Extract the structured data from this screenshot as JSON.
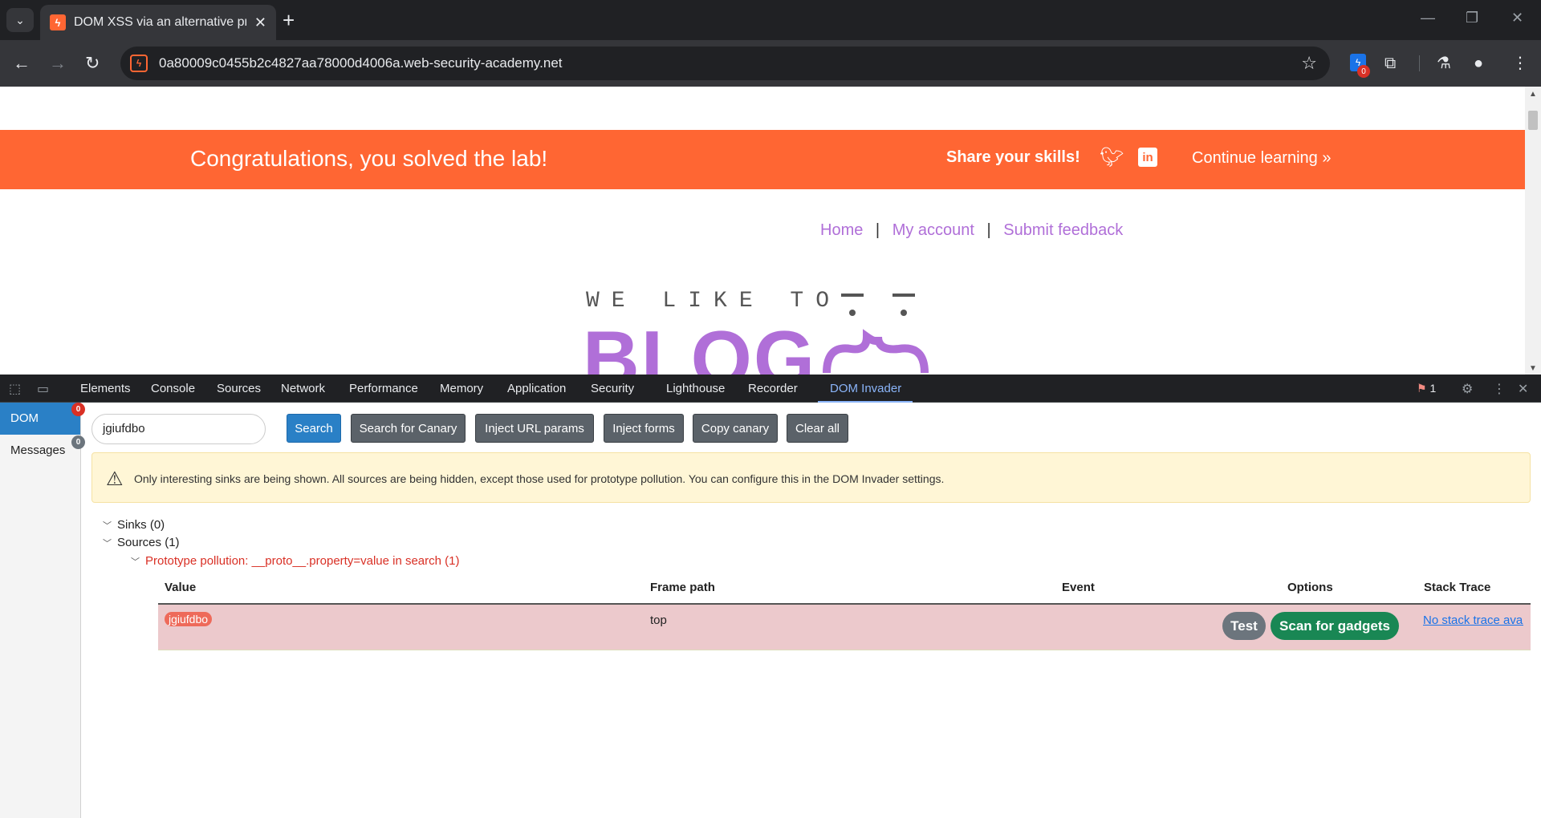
{
  "browser": {
    "tab_title": "DOM XSS via an alternative prototype pollution vector",
    "url": "0a80009c0455b2c4827aa78000d4006a.web-security-academy.net",
    "extension_count": "0"
  },
  "page": {
    "banner": {
      "message": "Congratulations, you solved the lab!",
      "share": "Share your skills!",
      "continue": "Continue learning"
    },
    "nav": {
      "home": "Home",
      "separator": "|",
      "my_account": "My account",
      "submit_feedback": "Submit feedback"
    },
    "logo": {
      "top": "WE LIKE TO",
      "main": "BLOG"
    }
  },
  "devtools": {
    "tabs": [
      "Elements",
      "Console",
      "Sources",
      "Network",
      "Performance",
      "Memory",
      "Application",
      "Security",
      "Lighthouse",
      "Recorder",
      "DOM Invader"
    ],
    "active_tab": "DOM Invader",
    "issues_count": "1",
    "sidebar": {
      "dom": {
        "label": "DOM",
        "badge": "0"
      },
      "messages": {
        "label": "Messages",
        "badge": "0"
      }
    },
    "canary_value": "jgiufdbo",
    "buttons": {
      "search": "Search",
      "search_canary": "Search for Canary",
      "inject_url": "Inject URL params",
      "inject_forms": "Inject forms",
      "copy_canary": "Copy canary",
      "clear_all": "Clear all"
    },
    "alert": "Only interesting sinks are being shown. All sources are being hidden, except those used for prototype pollution. You can configure this in the DOM Invader settings.",
    "tree": {
      "sinks": "Sinks (0)",
      "sources": "Sources (1)",
      "pollution": "Prototype pollution: __proto__.property=value in search (1)"
    },
    "table": {
      "headers": {
        "value": "Value",
        "frame_path": "Frame path",
        "event": "Event",
        "options": "Options",
        "stack_trace": "Stack Trace"
      },
      "row": {
        "value": "jgiufdbo",
        "frame_path": "top",
        "event": "",
        "test": "Test",
        "scan": "Scan for gadgets",
        "stack_trace": "No stack trace available"
      }
    },
    "colors": {
      "primary": "#2a80c6",
      "scan_button": "#198754",
      "test_button": "#6c757d",
      "row_highlight": "#ecc9cc"
    }
  }
}
